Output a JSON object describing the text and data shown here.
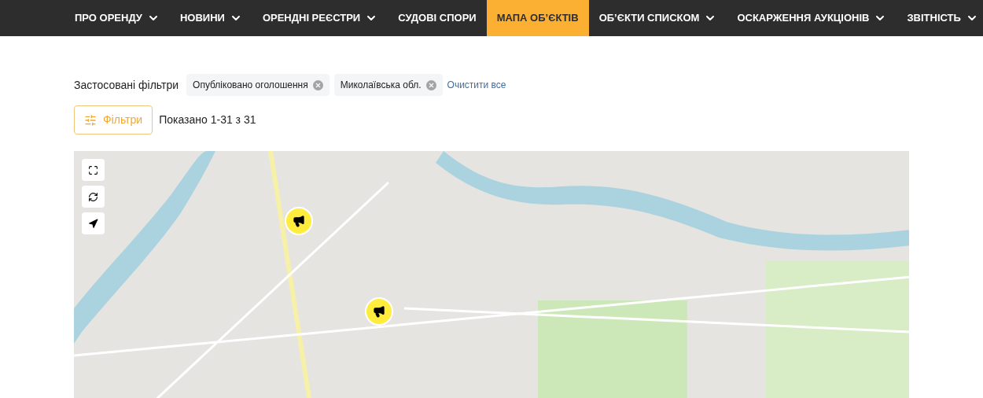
{
  "nav": [
    {
      "label": "ПРО ОРЕНДУ",
      "dropdown": true,
      "selected": false
    },
    {
      "label": "НОВИНИ",
      "dropdown": true,
      "selected": false
    },
    {
      "label": "ОРЕНДНІ РЕЄСТРИ",
      "dropdown": true,
      "selected": false
    },
    {
      "label": "СУДОВІ СПОРИ",
      "dropdown": false,
      "selected": false
    },
    {
      "label": "МАПА ОБ’ЄКТІВ",
      "dropdown": false,
      "selected": true
    },
    {
      "label": "ОБ’ЄКТИ СПИСКОМ",
      "dropdown": true,
      "selected": false
    },
    {
      "label": "ОСКАРЖЕННЯ АУКЦІОНІВ",
      "dropdown": true,
      "selected": false
    },
    {
      "label": "ЗВІТНІСТЬ",
      "dropdown": true,
      "selected": false
    }
  ],
  "filters": {
    "label": "Застосовані фільтри",
    "chips": [
      "Опубліковано оголошення",
      "Миколаївська обл."
    ],
    "clear": "Очистити все"
  },
  "filters_button": "Фільтри",
  "result_count": "Показано 1-31 з 31"
}
